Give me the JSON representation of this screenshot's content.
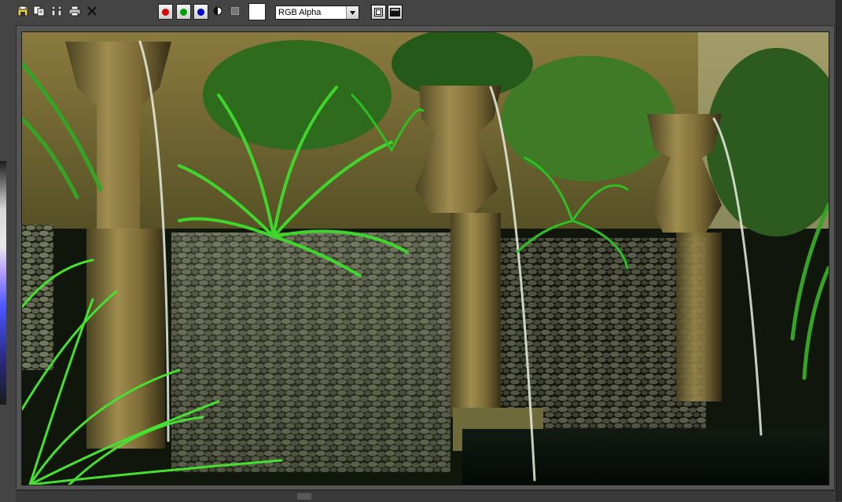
{
  "toolbar": {
    "icons": [
      "save-icon",
      "copy-icon",
      "clone-icon",
      "print-icon",
      "clear-icon"
    ],
    "channels": [
      {
        "name": "red-channel",
        "color": "#e00000"
      },
      {
        "name": "green-channel",
        "color": "#00a000"
      },
      {
        "name": "blue-channel",
        "color": "#0000d0"
      }
    ],
    "swatch_color": "#ffffff",
    "channel_display": {
      "selected": "RGB Alpha"
    }
  },
  "colors": {
    "background": "#444444",
    "frame": "#555555",
    "stone": "#6b5f3a",
    "foliage": "#3bbf2a",
    "water": "#0a120c"
  }
}
